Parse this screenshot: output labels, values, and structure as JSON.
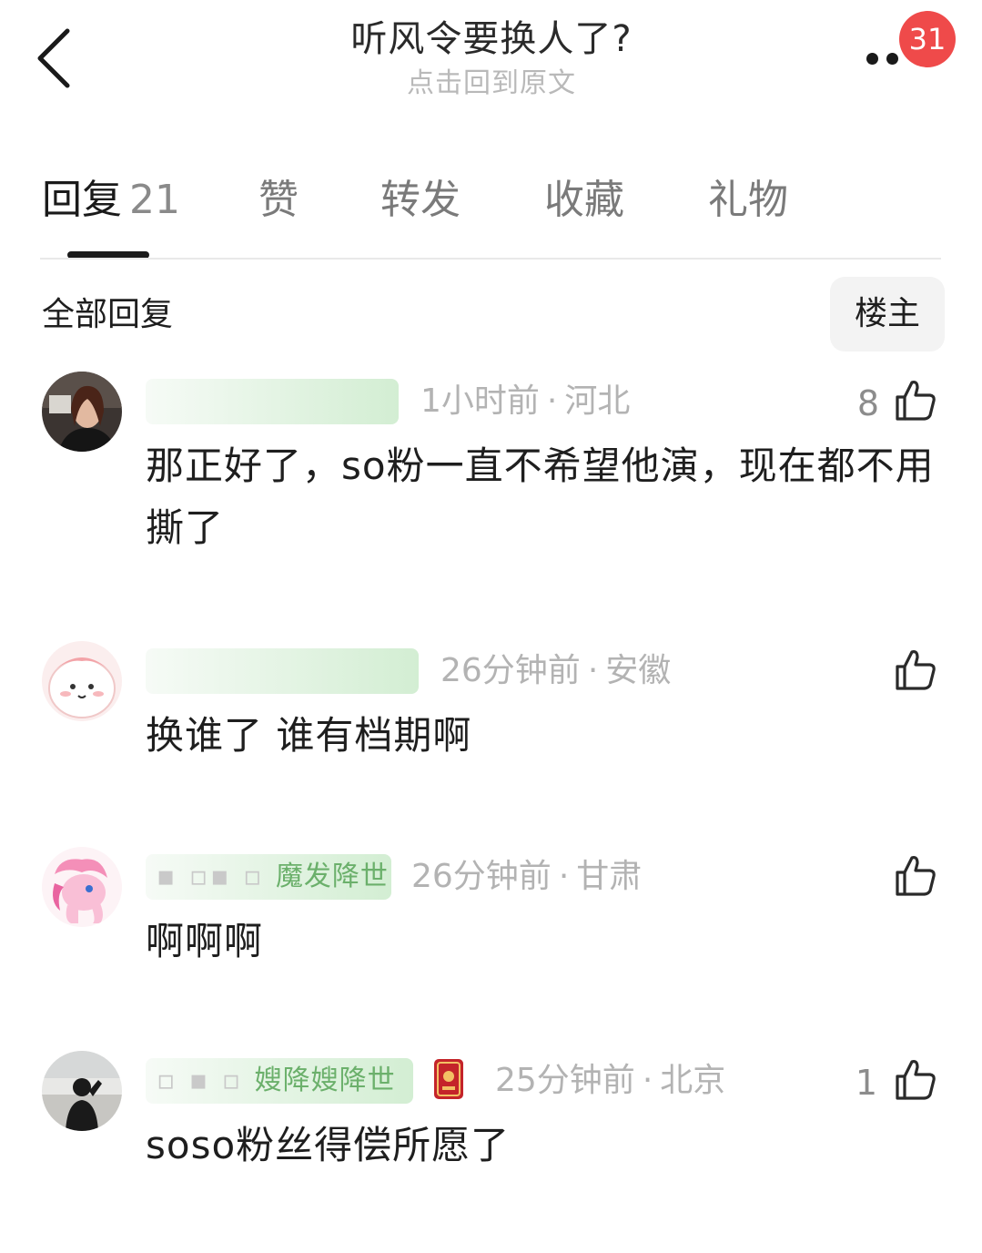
{
  "header": {
    "title": "听风令要换人了?",
    "subtitle": "点击回到原文",
    "notification_count": "31"
  },
  "tabs": [
    {
      "label": "回复",
      "count": "21",
      "active": true
    },
    {
      "label": "赞"
    },
    {
      "label": "转发"
    },
    {
      "label": "收藏"
    },
    {
      "label": "礼物"
    }
  ],
  "filter": {
    "section_label": "全部回复",
    "op_only_label": "楼主"
  },
  "comments": [
    {
      "user_name": "",
      "time": "1小时前",
      "location": "河北",
      "likes": "8",
      "text": "那正好了，so粉一直不希望他演，现在都不用撕了"
    },
    {
      "user_name": "",
      "time": "26分钟前",
      "location": "安徽",
      "likes": "",
      "text": "换谁了 谁有档期啊"
    },
    {
      "user_name": "魔发降世",
      "time": "26分钟前",
      "location": "甘肃",
      "likes": "",
      "text": "啊啊啊"
    },
    {
      "user_name": "嫂降嫂降世",
      "time": "25分钟前",
      "location": "北京",
      "likes": "1",
      "text": "soso粉丝得偿所愿了"
    }
  ],
  "colors": {
    "badge": "#ef4a4a",
    "username_highlight": "#6bb06b",
    "meta_text": "#b3b3b3",
    "subtitle_text": "#b9b9b9"
  },
  "icons": {
    "back": "chevron-left-icon",
    "more": "more-dots-icon",
    "like": "thumbs-up-icon",
    "medal": "red-medal-badge-icon"
  }
}
